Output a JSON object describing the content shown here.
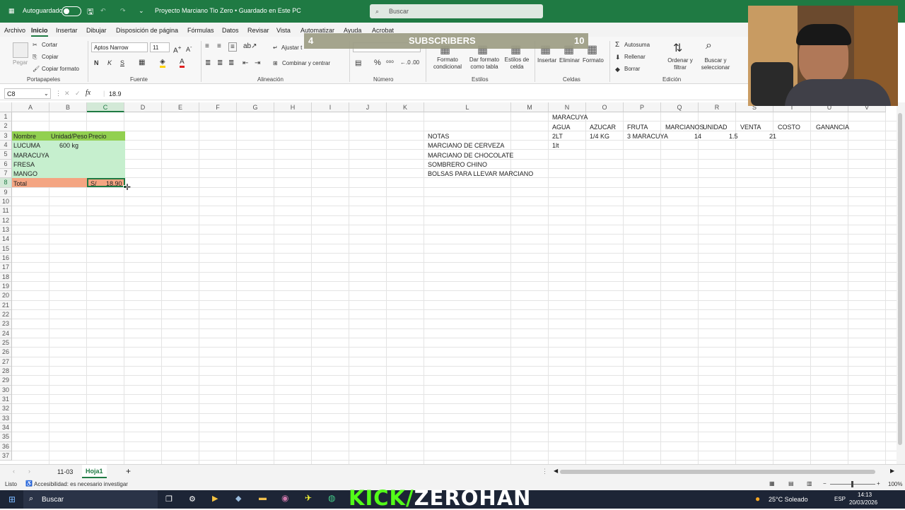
{
  "titlebar": {
    "autosave_label": "Autoguardado",
    "doc_title": "Proyecto Marciano Tio Zero • Guardado en Este PC",
    "search_placeholder": "Buscar"
  },
  "menu": [
    "Archivo",
    "Inicio",
    "Insertar",
    "Dibujar",
    "Disposición de página",
    "Fórmulas",
    "Datos",
    "Revisar",
    "Vista",
    "Automatizar",
    "Ayuda",
    "Acrobat"
  ],
  "ribbon": {
    "portapapeles": {
      "pegar": "Pegar",
      "cortar": "Cortar",
      "copiar": "Copiar",
      "copiar_formato": "Copiar formato",
      "label": "Portapapeles"
    },
    "fuente": {
      "font": "Aptos Narrow",
      "size": "11",
      "bold": "N",
      "italic": "K",
      "underline": "S",
      "label": "Fuente"
    },
    "alineacion": {
      "ajustar": "Ajustar t",
      "combinar": "Combinar y centrar",
      "label": "Alineación"
    },
    "numero": {
      "label": "Número",
      "percent": "%"
    },
    "estilos": {
      "formato_cond": "Formato condicional",
      "formato_tabla": "Dar formato como tabla",
      "estilos_celda": "Estilos de celda",
      "label": "Estilos"
    },
    "celdas": {
      "insertar": "Insertar",
      "eliminar": "Eliminar",
      "formato": "Formato",
      "label": "Celdas"
    },
    "edicion": {
      "autosuma": "Autosuma",
      "rellenar": "Rellenar",
      "borrar": "Borrar",
      "ordenar": "Ordenar y filtrar",
      "buscar": "Buscar y seleccionar",
      "label": "Edición"
    },
    "overlay": {
      "left": "4",
      "mid": "SUBSCRIBERS",
      "right": "10"
    }
  },
  "formula_bar": {
    "name_box": "C8",
    "value": "18.9"
  },
  "columns": [
    "A",
    "B",
    "C",
    "D",
    "E",
    "F",
    "G",
    "H",
    "I",
    "J",
    "K",
    "L",
    "M",
    "N",
    "O",
    "P",
    "Q",
    "R",
    "S",
    "T",
    "U",
    "V"
  ],
  "cells": {
    "A3": "Nombre",
    "B3": "Unidad/Peso",
    "C3": "Precio",
    "A4": "LUCUMA",
    "B4": "600 kg",
    "A5": "MARACUYA",
    "A6": "FRESA",
    "A7": "MANGO",
    "A8": "Total",
    "C8_currency": "S/",
    "C8_value": "18.90",
    "L3": "NOTAS",
    "L4": "MARCIANO DE CERVEZA",
    "L5": "MARCIANO DE CHOCOLATE",
    "L6": "SOMBRERO CHINO",
    "L7": "BOLSAS PARA LLEVAR MARCIANO",
    "N1": "MARACUYA",
    "N2": "AGUA",
    "O2": "AZUCAR",
    "P2": "FRUTA",
    "Q2": "MARCIANOS",
    "R2": "UNIDAD",
    "S2": "VENTA",
    "T2": "COSTO",
    "U2": "GANANCIA",
    "N3": "2LT",
    "O3": "1/4 KG",
    "P3": "3 MARACUYA",
    "Q3": "14",
    "R3": "1.5",
    "S3": "21",
    "N4": "1lt"
  },
  "sheets": [
    "11-03",
    "Hoja1"
  ],
  "active_sheet": "Hoja1",
  "status": {
    "ready": "Listo",
    "accessibility": "Accesibilidad: es necesario investigar",
    "zoom": "100%"
  },
  "taskbar": {
    "search": "Buscar",
    "weather": "25°C Soleado",
    "lang": "ESP",
    "time": "14:13",
    "date": "20/03/2026"
  },
  "overlay_brand": {
    "a": "KICK/",
    "b": "ZEROHAN"
  },
  "colors": {
    "excel_green": "#1f7a43",
    "header_fill": "#92d050",
    "table_fill": "#c6efce",
    "total_fill": "#f4a582"
  }
}
